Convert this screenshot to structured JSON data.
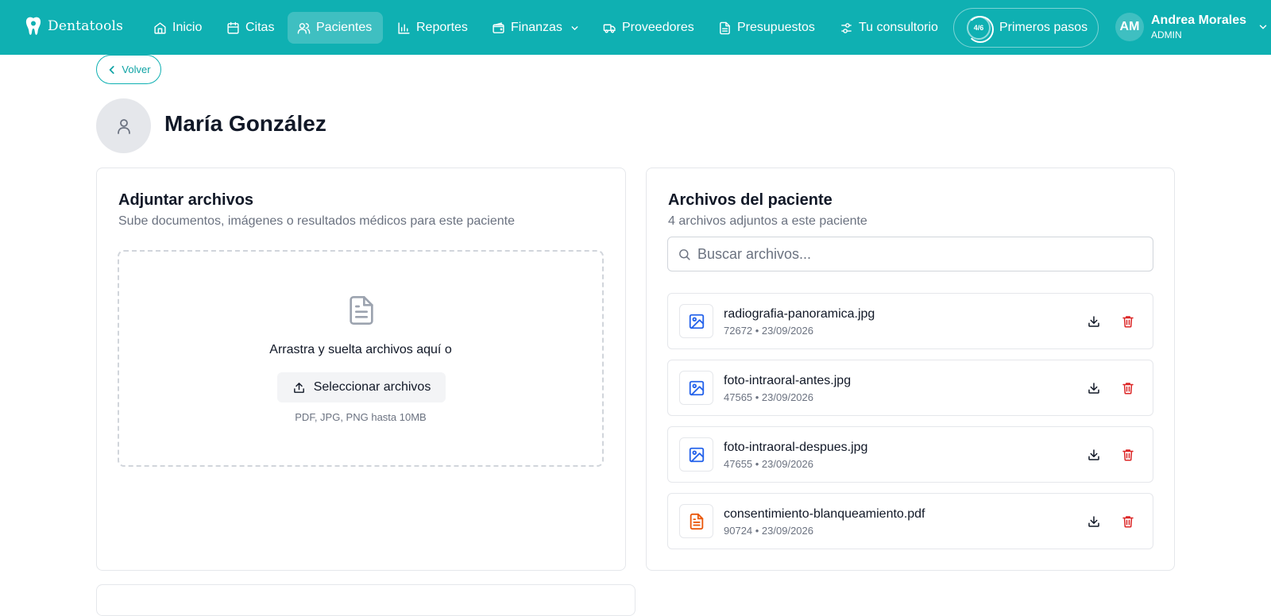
{
  "brand": {
    "name": "Dentatools"
  },
  "nav": {
    "items": [
      {
        "label": "Inicio"
      },
      {
        "label": "Citas"
      },
      {
        "label": "Pacientes"
      },
      {
        "label": "Reportes"
      },
      {
        "label": "Finanzas"
      },
      {
        "label": "Proveedores"
      },
      {
        "label": "Presupuestos"
      },
      {
        "label": "Tu consultorio"
      }
    ],
    "active": "Pacientes",
    "onboarding": {
      "progress": "4/6",
      "label": "Primeros pasos",
      "progress_fraction": 0.667
    },
    "user": {
      "initials": "AM",
      "name": "Andrea Morales",
      "role": "ADMIN"
    }
  },
  "back": {
    "label": "Volver"
  },
  "patient": {
    "name": "María González"
  },
  "upload": {
    "title": "Adjuntar archivos",
    "subtitle": "Sube documentos, imágenes o resultados médicos para este paciente",
    "drop_text": "Arrastra y suelta archivos aquí o",
    "button_label": "Seleccionar archivos",
    "hint": "PDF, JPG, PNG hasta 10MB"
  },
  "files": {
    "title": "Archivos del paciente",
    "subtitle": "4 archivos adjuntos a este paciente",
    "search_placeholder": "Buscar archivos...",
    "items": [
      {
        "name": "radiografia-panoramica.jpg",
        "meta": "72672 • 23/09/2026",
        "type": "image"
      },
      {
        "name": "foto-intraoral-antes.jpg",
        "meta": "47565 • 23/09/2026",
        "type": "image"
      },
      {
        "name": "foto-intraoral-despues.jpg",
        "meta": "47655 • 23/09/2026",
        "type": "image"
      },
      {
        "name": "consentimiento-blanqueamiento.pdf",
        "meta": "90724 • 23/09/2026",
        "type": "pdf"
      }
    ]
  },
  "colors": {
    "brand": "#0fb0b2",
    "image_icon": "#2563eb",
    "pdf_icon": "#ea580c",
    "delete": "#dc2626"
  }
}
